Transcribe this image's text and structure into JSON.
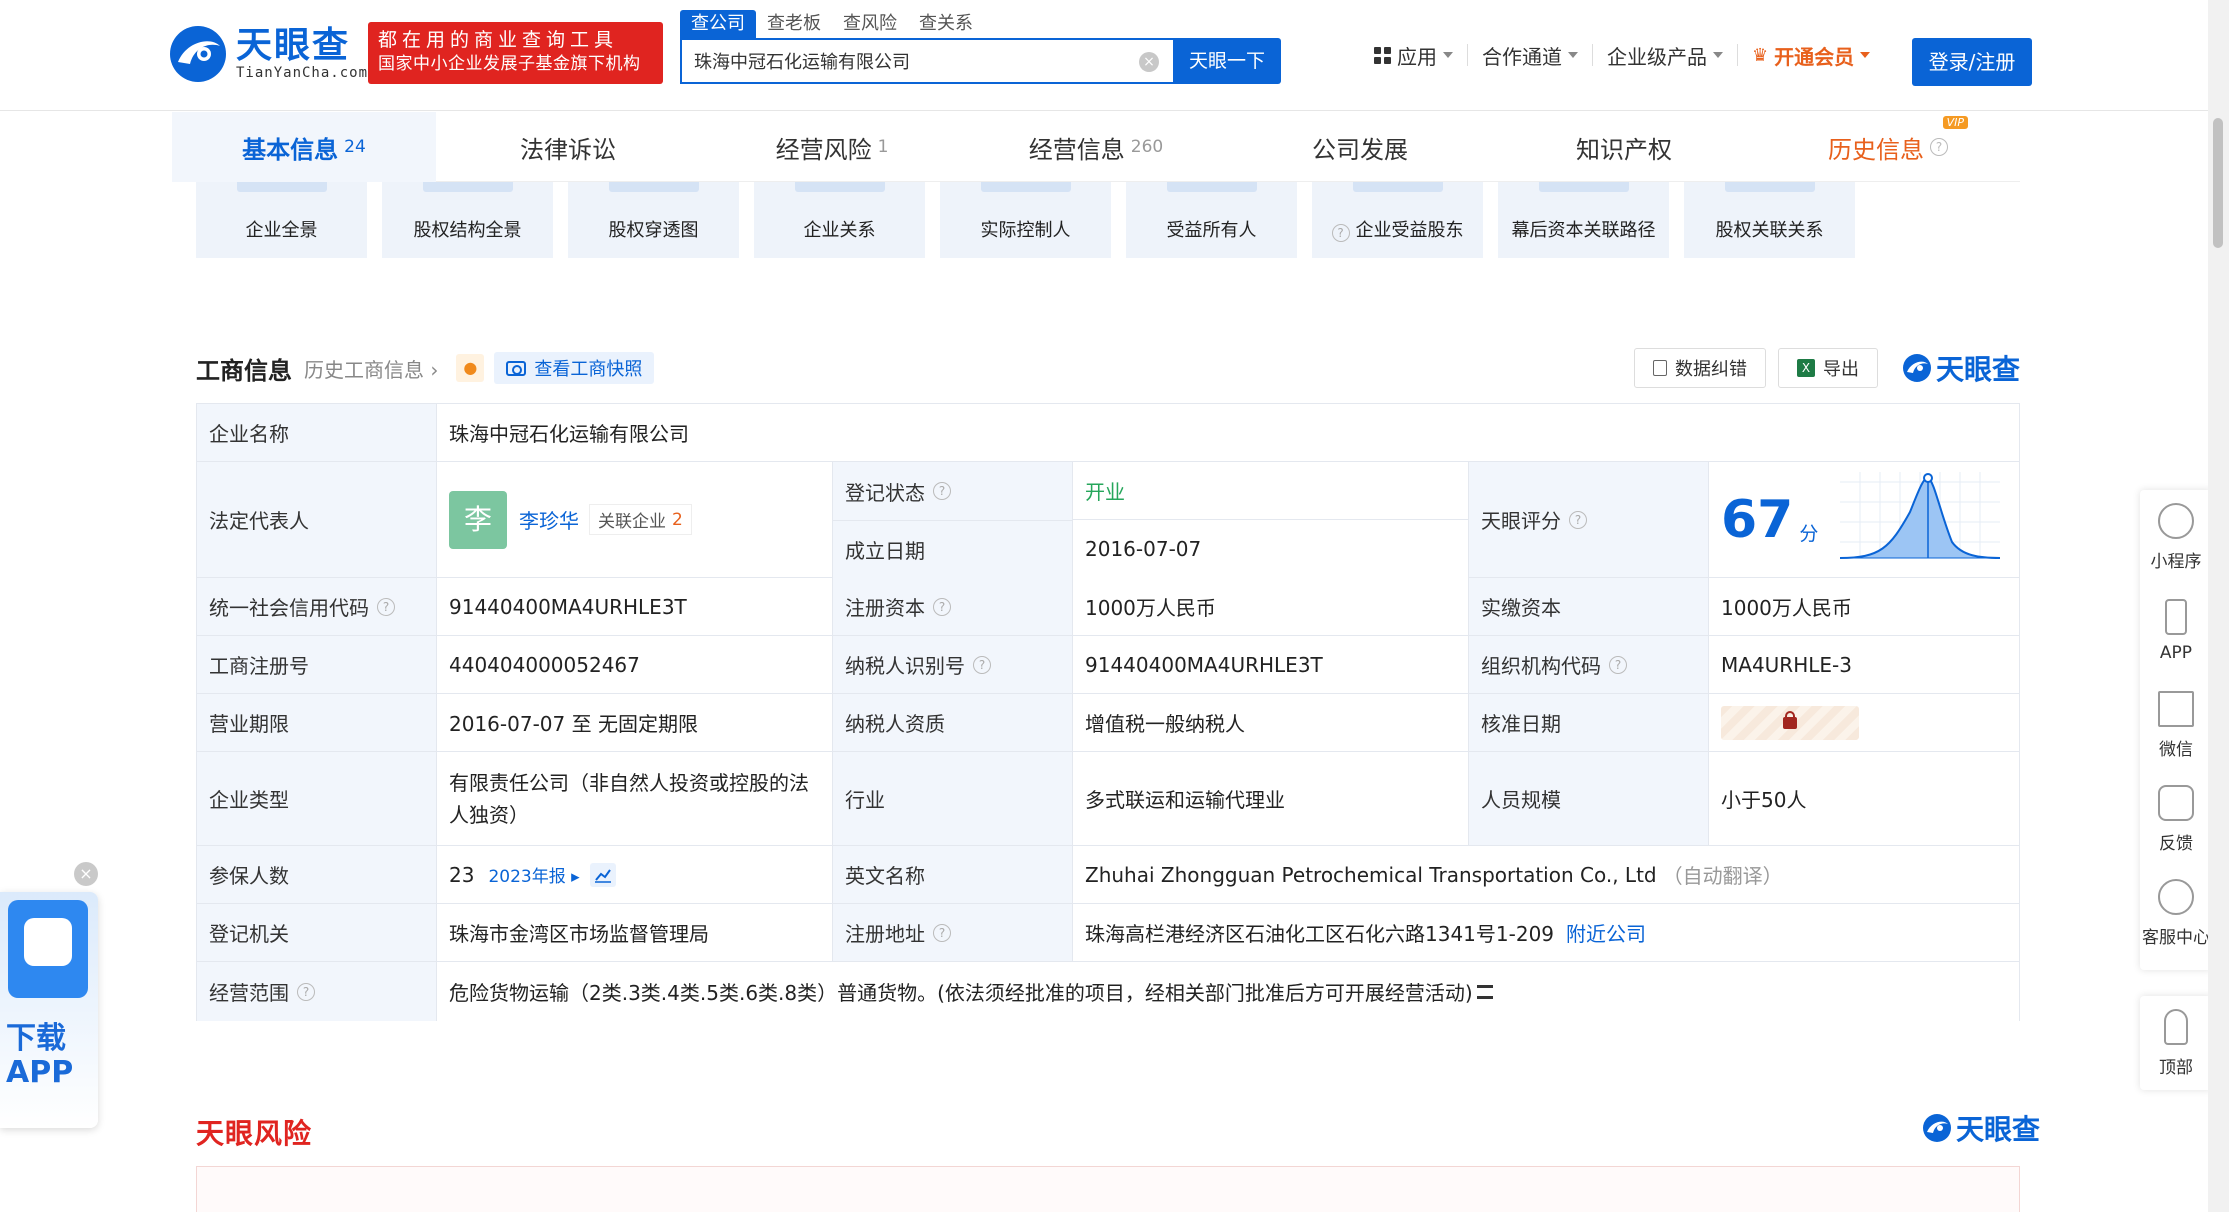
{
  "header": {
    "logo_cn": "天眼查",
    "logo_en": "TianYanCha.com",
    "slogan_line1": "都在用的商业查询工具",
    "slogan_line2": "国家中小企业发展子基金旗下机构",
    "search_tabs": [
      "查公司",
      "查老板",
      "查风险",
      "查关系"
    ],
    "search_value": "珠海中冠石化运输有限公司",
    "search_button": "天眼一下",
    "nav": {
      "apps": "应用",
      "partner": "合作通道",
      "enterprise": "企业级产品",
      "vip": "开通会员"
    },
    "login": "登录/注册"
  },
  "tabs": [
    {
      "label": "基本信息",
      "count": "24"
    },
    {
      "label": "法律诉讼",
      "count": ""
    },
    {
      "label": "经营风险",
      "count": "1"
    },
    {
      "label": "经营信息",
      "count": "260"
    },
    {
      "label": "公司发展",
      "count": ""
    },
    {
      "label": "知识产权",
      "count": ""
    },
    {
      "label": "历史信息",
      "count": ""
    }
  ],
  "vip_badge": "VIP",
  "tiles": [
    "企业全景",
    "股权结构全景",
    "股权穿透图",
    "企业关系",
    "实际控制人",
    "受益所有人",
    "企业受益股东",
    "幕后资本关联路径",
    "股权关联关系"
  ],
  "section": {
    "title": "工商信息",
    "history_link": "历史工商信息",
    "snapshot": "查看工商快照",
    "correct": "数据纠错",
    "export": "导出",
    "brand": "天眼查"
  },
  "info": {
    "company_name_label": "企业名称",
    "company_name": "珠海中冠石化运输有限公司",
    "legal_rep_label": "法定代表人",
    "legal_rep_avatar": "李",
    "legal_rep": "李珍华",
    "related_label": "关联企业",
    "related_count": "2",
    "reg_status_label": "登记状态",
    "reg_status": "开业",
    "found_date_label": "成立日期",
    "found_date": "2016-07-07",
    "score_label": "天眼评分",
    "score": "67",
    "score_unit": "分",
    "credit_code_label": "统一社会信用代码",
    "credit_code": "91440400MA4URHLE3T",
    "reg_capital_label": "注册资本",
    "reg_capital": "1000万人民币",
    "paid_capital_label": "实缴资本",
    "paid_capital": "1000万人民币",
    "reg_no_label": "工商注册号",
    "reg_no": "440404000052467",
    "tax_id_label": "纳税人识别号",
    "tax_id": "91440400MA4URHLE3T",
    "org_code_label": "组织机构代码",
    "org_code": "MA4URHLE-3",
    "term_label": "营业期限",
    "term": "2016-07-07 至 无固定期限",
    "taxpayer_label": "纳税人资质",
    "taxpayer": "增值税一般纳税人",
    "approve_label": "核准日期",
    "type_label": "企业类型",
    "type": "有限责任公司（非自然人投资或控股的法人独资）",
    "industry_label": "行业",
    "industry": "多式联运和运输代理业",
    "staff_label": "人员规模",
    "staff": "小于50人",
    "insured_label": "参保人数",
    "insured": "23",
    "insured_report": "2023年报",
    "en_name_label": "英文名称",
    "en_name": "Zhuhai Zhongguan Petrochemical Transportation Co., Ltd",
    "en_name_note": "（自动翻译）",
    "authority_label": "登记机关",
    "authority": "珠海市金湾区市场监督管理局",
    "address_label": "注册地址",
    "address": "珠海高栏港经济区石油化工区石化六路1341号1-209",
    "nearby": "附近公司",
    "scope_label": "经营范围",
    "scope": "危险货物运输（2类.3类.4类.5类.6类.8类）普通货物。(依法须经批准的项目，经相关部门批准后方可开展经营活动)"
  },
  "risk": {
    "title": "天眼风险",
    "brand": "天眼查"
  },
  "side": [
    "小程序",
    "APP",
    "微信",
    "反馈",
    "客服中心"
  ],
  "side_top": "顶部",
  "download": {
    "line1": "下载",
    "line2": "APP"
  },
  "colors": {
    "brand_blue": "#0a64d6",
    "red": "#e02420",
    "orange": "#e8601c",
    "green": "#26a65b"
  }
}
